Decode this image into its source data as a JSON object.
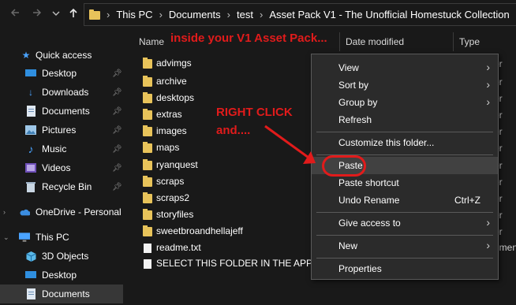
{
  "address_bar": {
    "crumbs": [
      "This PC",
      "Documents",
      "test",
      "Asset Pack V1 - The Unofficial Homestuck Collection"
    ]
  },
  "nav": {
    "back_icon": "arrow-left-icon",
    "forward_icon": "arrow-right-icon",
    "recent_icon": "chevron-down-icon",
    "up_icon": "arrow-up-icon"
  },
  "columns": {
    "name": "Name",
    "date_modified": "Date modified",
    "type": "Type"
  },
  "sidebar": {
    "quick_access": "Quick access",
    "items": [
      {
        "label": "Desktop",
        "icon": "desktop-icon",
        "pinned": true
      },
      {
        "label": "Downloads",
        "icon": "downloads-icon",
        "pinned": true
      },
      {
        "label": "Documents",
        "icon": "documents-icon",
        "pinned": true
      },
      {
        "label": "Pictures",
        "icon": "pictures-icon",
        "pinned": true
      },
      {
        "label": "Music",
        "icon": "music-icon",
        "pinned": true
      },
      {
        "label": "Videos",
        "icon": "videos-icon",
        "pinned": true
      },
      {
        "label": "Recycle Bin",
        "icon": "recycle-bin-icon",
        "pinned": true
      }
    ],
    "onedrive": "OneDrive - Personal",
    "this_pc": "This PC",
    "pc_items": [
      {
        "label": "3D Objects",
        "icon": "3d-objects-icon"
      },
      {
        "label": "Desktop",
        "icon": "desktop-icon"
      },
      {
        "label": "Documents",
        "icon": "documents-icon"
      }
    ]
  },
  "files": [
    {
      "name": "advimgs",
      "kind": "folder"
    },
    {
      "name": "archive",
      "kind": "folder"
    },
    {
      "name": "desktops",
      "kind": "folder"
    },
    {
      "name": "extras",
      "kind": "folder"
    },
    {
      "name": "images",
      "kind": "folder"
    },
    {
      "name": "maps",
      "kind": "folder"
    },
    {
      "name": "ryanquest",
      "kind": "folder"
    },
    {
      "name": "scraps",
      "kind": "folder"
    },
    {
      "name": "scraps2",
      "kind": "folder"
    },
    {
      "name": "storyfiles",
      "kind": "folder"
    },
    {
      "name": "sweetbroandhellajeff",
      "kind": "folder"
    },
    {
      "name": "readme.txt",
      "kind": "text"
    },
    {
      "name": "SELECT THIS FOLDER IN THE APP",
      "kind": "text"
    }
  ],
  "type_column_clipped": [
    "er",
    "er",
    "er",
    "er",
    "er",
    "er",
    "er",
    "er",
    "er",
    "er",
    "er",
    "umen"
  ],
  "context_menu": {
    "view": "View",
    "sort_by": "Sort by",
    "group_by": "Group by",
    "refresh": "Refresh",
    "customize": "Customize this folder...",
    "paste": "Paste",
    "paste_shortcut": "Paste shortcut",
    "undo_rename": "Undo Rename",
    "undo_shortcut": "Ctrl+Z",
    "give_access": "Give access to",
    "new": "New",
    "properties": "Properties"
  },
  "annotations": {
    "top": "inside your V1 Asset Pack...",
    "right_click": "RIGHT CLICK",
    "and": "and....",
    "color": "#e11b1b"
  }
}
